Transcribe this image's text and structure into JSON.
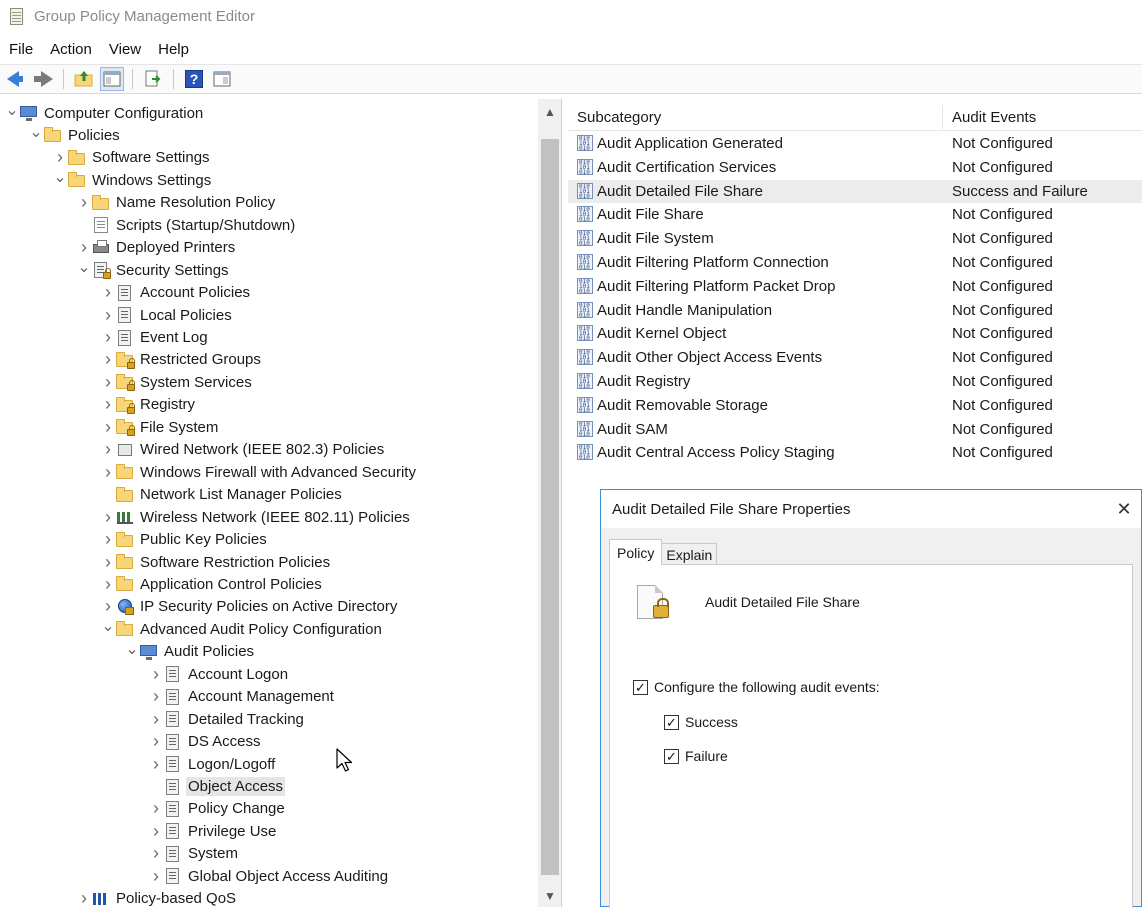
{
  "window": {
    "title": "Group Policy Management Editor"
  },
  "menu": [
    "File",
    "Action",
    "View",
    "Help"
  ],
  "toolbar": {
    "buttons": [
      "back-arrow-icon",
      "forward-arrow-icon",
      "up-folder-icon",
      "show-hide-tree-icon",
      "export-list-icon",
      "help-icon",
      "view-icon"
    ],
    "help_glyph": "?"
  },
  "tree": {
    "items": [
      {
        "label": "Computer Configuration",
        "level": 0,
        "icon": "computer-icon",
        "expander": "expanded"
      },
      {
        "label": "Policies",
        "level": 1,
        "icon": "folder-icon",
        "expander": "expanded"
      },
      {
        "label": "Software Settings",
        "level": 2,
        "icon": "folder-icon",
        "expander": "collapsed"
      },
      {
        "label": "Windows Settings",
        "level": 2,
        "icon": "folder-icon",
        "expander": "expanded"
      },
      {
        "label": "Name Resolution Policy",
        "level": 3,
        "icon": "folder-icon",
        "expander": "collapsed"
      },
      {
        "label": "Scripts (Startup/Shutdown)",
        "level": 3,
        "icon": "script-icon",
        "expander": "none"
      },
      {
        "label": "Deployed Printers",
        "level": 3,
        "icon": "printer-icon",
        "expander": "collapsed"
      },
      {
        "label": "Security Settings",
        "level": 3,
        "icon": "security-settings-icon",
        "expander": "expanded"
      },
      {
        "label": "Account Policies",
        "level": 4,
        "icon": "policy-list-icon",
        "expander": "collapsed"
      },
      {
        "label": "Local Policies",
        "level": 4,
        "icon": "policy-list-icon",
        "expander": "collapsed"
      },
      {
        "label": "Event Log",
        "level": 4,
        "icon": "policy-list-icon",
        "expander": "collapsed"
      },
      {
        "label": "Restricted Groups",
        "level": 4,
        "icon": "locked-folder-icon",
        "expander": "collapsed"
      },
      {
        "label": "System Services",
        "level": 4,
        "icon": "locked-folder-icon",
        "expander": "collapsed"
      },
      {
        "label": "Registry",
        "level": 4,
        "icon": "locked-folder-icon",
        "expander": "collapsed"
      },
      {
        "label": "File System",
        "level": 4,
        "icon": "locked-folder-icon",
        "expander": "collapsed"
      },
      {
        "label": "Wired Network (IEEE 802.3) Policies",
        "level": 4,
        "icon": "network-icon",
        "expander": "collapsed"
      },
      {
        "label": "Windows Firewall with Advanced Security",
        "level": 4,
        "icon": "folder-icon",
        "expander": "collapsed"
      },
      {
        "label": "Network List Manager Policies",
        "level": 4,
        "icon": "folder-icon",
        "expander": "none"
      },
      {
        "label": "Wireless Network (IEEE 802.11) Policies",
        "level": 4,
        "icon": "wireless-icon",
        "expander": "collapsed"
      },
      {
        "label": "Public Key Policies",
        "level": 4,
        "icon": "folder-icon",
        "expander": "collapsed"
      },
      {
        "label": "Software Restriction Policies",
        "level": 4,
        "icon": "folder-icon",
        "expander": "collapsed"
      },
      {
        "label": "Application Control Policies",
        "level": 4,
        "icon": "folder-icon",
        "expander": "collapsed"
      },
      {
        "label": "IP Security Policies on Active Directory",
        "level": 4,
        "icon": "ip-security-icon",
        "expander": "collapsed"
      },
      {
        "label": "Advanced Audit Policy Configuration",
        "level": 4,
        "icon": "folder-icon",
        "expander": "expanded"
      },
      {
        "label": "Audit Policies",
        "level": 5,
        "icon": "computer-icon",
        "expander": "expanded"
      },
      {
        "label": "Account Logon",
        "level": 6,
        "icon": "policy-list-icon",
        "expander": "collapsed"
      },
      {
        "label": "Account Management",
        "level": 6,
        "icon": "policy-list-icon",
        "expander": "collapsed"
      },
      {
        "label": "Detailed Tracking",
        "level": 6,
        "icon": "policy-list-icon",
        "expander": "collapsed"
      },
      {
        "label": "DS Access",
        "level": 6,
        "icon": "policy-list-icon",
        "expander": "collapsed"
      },
      {
        "label": "Logon/Logoff",
        "level": 6,
        "icon": "policy-list-icon",
        "expander": "collapsed"
      },
      {
        "label": "Object Access",
        "level": 6,
        "icon": "policy-list-icon",
        "expander": "none",
        "selected": true
      },
      {
        "label": "Policy Change",
        "level": 6,
        "icon": "policy-list-icon",
        "expander": "collapsed"
      },
      {
        "label": "Privilege Use",
        "level": 6,
        "icon": "policy-list-icon",
        "expander": "collapsed"
      },
      {
        "label": "System",
        "level": 6,
        "icon": "policy-list-icon",
        "expander": "collapsed"
      },
      {
        "label": "Global Object Access Auditing",
        "level": 6,
        "icon": "policy-list-icon",
        "expander": "collapsed"
      },
      {
        "label": "Policy-based QoS",
        "level": 3,
        "icon": "qos-icon",
        "expander": "collapsed"
      }
    ]
  },
  "list": {
    "columns": [
      "Subcategory",
      "Audit Events"
    ],
    "rows": [
      {
        "name": "Audit Application Generated",
        "value": "Not Configured"
      },
      {
        "name": "Audit Certification Services",
        "value": "Not Configured"
      },
      {
        "name": "Audit Detailed File Share",
        "value": "Success and Failure",
        "selected": true
      },
      {
        "name": "Audit File Share",
        "value": "Not Configured"
      },
      {
        "name": "Audit File System",
        "value": "Not Configured"
      },
      {
        "name": "Audit Filtering Platform Connection",
        "value": "Not Configured"
      },
      {
        "name": "Audit Filtering Platform Packet Drop",
        "value": "Not Configured"
      },
      {
        "name": "Audit Handle Manipulation",
        "value": "Not Configured"
      },
      {
        "name": "Audit Kernel Object",
        "value": "Not Configured"
      },
      {
        "name": "Audit Other Object Access Events",
        "value": "Not Configured"
      },
      {
        "name": "Audit Registry",
        "value": "Not Configured"
      },
      {
        "name": "Audit Removable Storage",
        "value": "Not Configured"
      },
      {
        "name": "Audit SAM",
        "value": "Not Configured"
      },
      {
        "name": "Audit Central Access Policy Staging",
        "value": "Not Configured"
      }
    ]
  },
  "dialog": {
    "title": "Audit Detailed File Share Properties",
    "close_glyph": "✕",
    "tabs": [
      {
        "label": "Policy",
        "active": true
      },
      {
        "label": "Explain",
        "active": false
      }
    ],
    "policy_name": "Audit Detailed File Share",
    "configure": {
      "label": "Configure the following audit events:",
      "checked": true
    },
    "success": {
      "label": "Success",
      "checked": true
    },
    "failure": {
      "label": "Failure",
      "checked": true
    },
    "check_glyph": "✓"
  },
  "colors": {
    "accent": "#3c8fd8",
    "selection": "#e5e5e5"
  }
}
